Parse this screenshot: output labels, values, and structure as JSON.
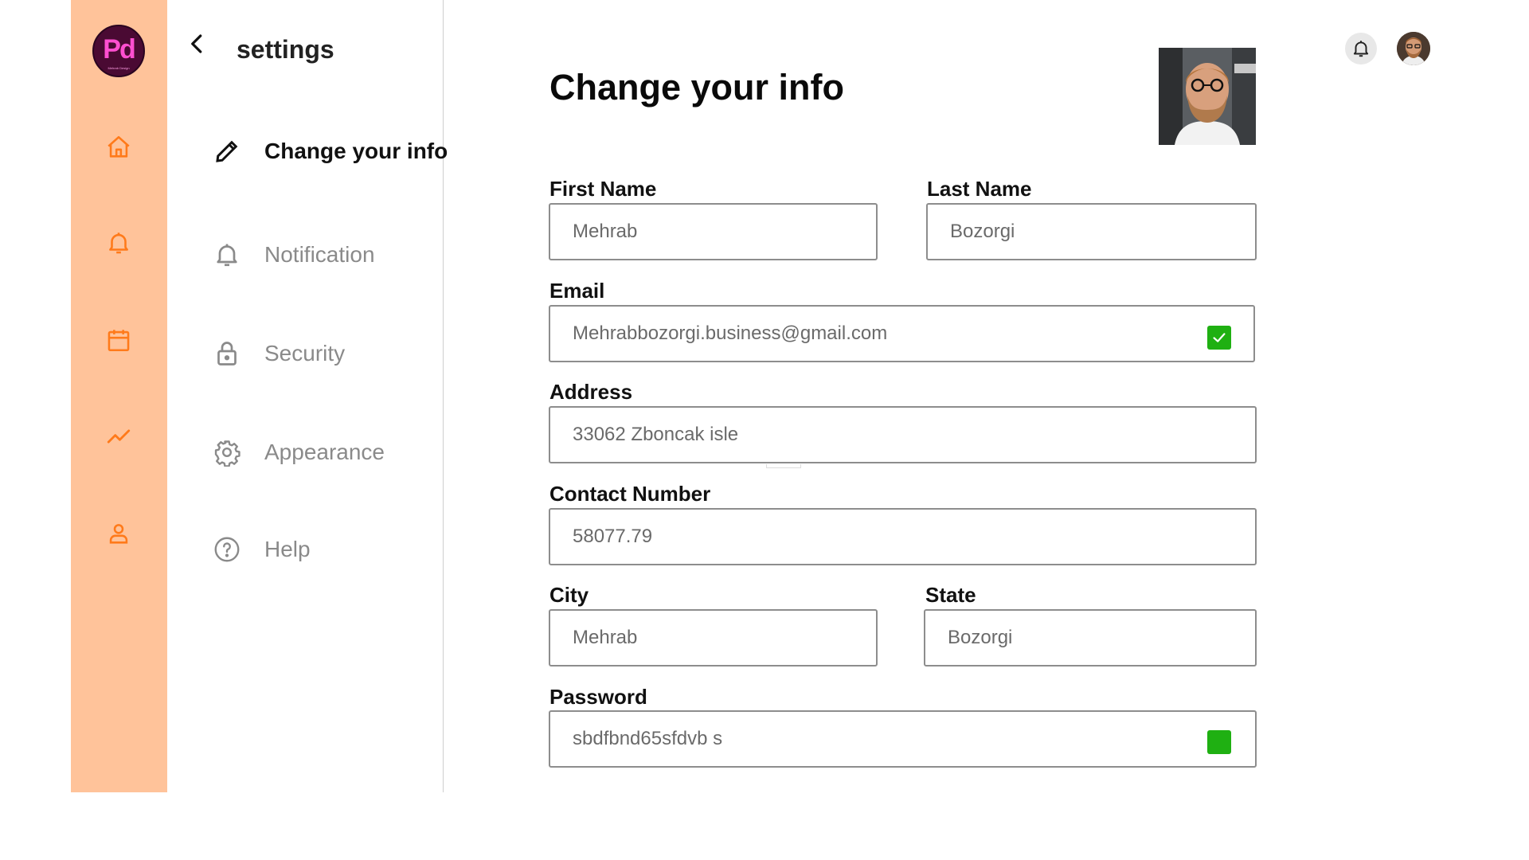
{
  "logo": {
    "text": "Pd",
    "tagline": "Mehrab Design"
  },
  "rail": {
    "items": [
      "home",
      "notifications",
      "calendar",
      "analytics",
      "profile"
    ]
  },
  "settings": {
    "title": "settings",
    "items": [
      {
        "label": "Change your info",
        "icon": "pencil-icon",
        "active": true
      },
      {
        "label": "Notification",
        "icon": "bell-icon"
      },
      {
        "label": "Security",
        "icon": "lock-icon"
      },
      {
        "label": "Appearance",
        "icon": "gear-icon"
      },
      {
        "label": "Help",
        "icon": "help-icon"
      }
    ]
  },
  "page": {
    "title": "Change your info"
  },
  "form": {
    "first_name": {
      "label": "First Name",
      "value": "Mehrab"
    },
    "last_name": {
      "label": "Last Name",
      "value": "Bozorgi"
    },
    "email": {
      "label": "Email",
      "value": "Mehrabbozorgi.business@gmail.com",
      "verified": true
    },
    "address": {
      "label": "Address",
      "value": "33062 Zboncak isle"
    },
    "contact": {
      "label": "Contact Number",
      "value": "58077.79"
    },
    "city": {
      "label": "City",
      "value": "Mehrab"
    },
    "state": {
      "label": "State",
      "value": "Bozorgi"
    },
    "password": {
      "label": "Password",
      "value": "sbdfbnd65sfdvb s"
    }
  },
  "colors": {
    "accent": "#ff7a1a",
    "rail_bg": "#ffc39a",
    "success": "#1fb012",
    "logo_bg": "#4a0a33",
    "logo_text": "#ff4fd0"
  }
}
